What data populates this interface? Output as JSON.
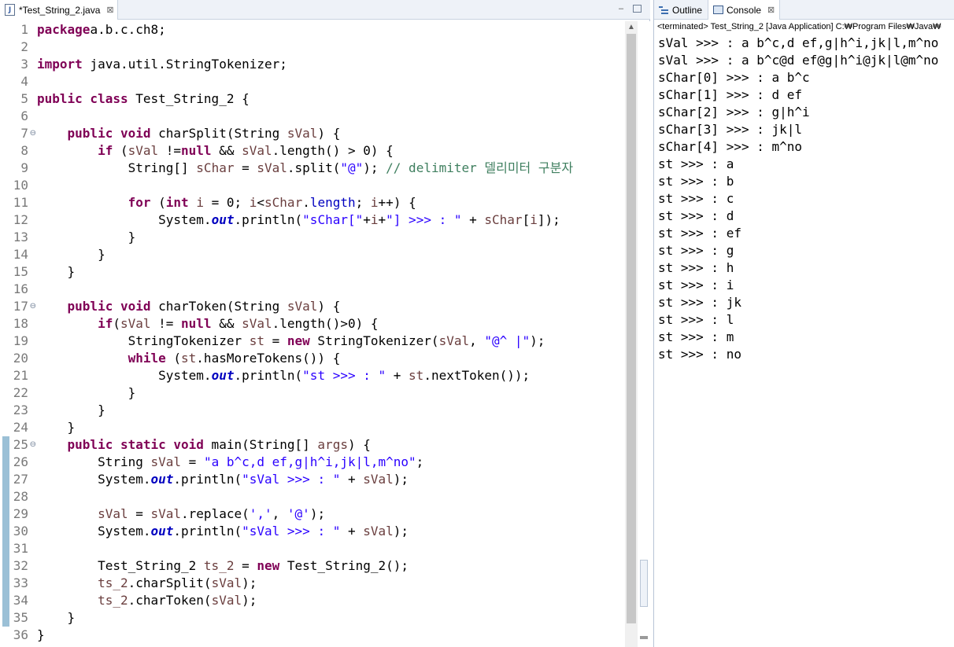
{
  "editor": {
    "tab_label": "*Test_String_2.java",
    "file_icon": "java-file-icon",
    "close_glyph": "⊠",
    "minimize_glyph": "▭"
  },
  "line_numbers": [
    "1",
    "2",
    "3",
    "4",
    "5",
    "6",
    "7",
    "8",
    "9",
    "10",
    "11",
    "12",
    "13",
    "14",
    "15",
    "16",
    "17",
    "18",
    "19",
    "20",
    "21",
    "22",
    "23",
    "24",
    "25",
    "26",
    "27",
    "28",
    "29",
    "30",
    "31",
    "32",
    "33",
    "34",
    "35",
    "36"
  ],
  "fold_markers": {
    "7": "⊖",
    "17": "⊖",
    "25": "⊖"
  },
  "code_lines": [
    [
      [
        "kw",
        "package"
      ],
      [
        "",
        "a.b.c.ch8;"
      ]
    ],
    [],
    [
      [
        "kw",
        "import"
      ],
      [
        "",
        " java.util.StringTokenizer;"
      ]
    ],
    [],
    [
      [
        "kw",
        "public class"
      ],
      [
        "",
        " Test_String_2 {"
      ]
    ],
    [],
    [
      [
        "",
        "    "
      ],
      [
        "kw",
        "public void"
      ],
      [
        "",
        " charSplit(String "
      ],
      [
        "lv",
        "sVal"
      ],
      [
        "",
        ") {"
      ]
    ],
    [
      [
        "",
        "        "
      ],
      [
        "kw",
        "if"
      ],
      [
        "",
        " ("
      ],
      [
        "lv",
        "sVal"
      ],
      [
        "",
        " !="
      ],
      [
        "kw",
        "null"
      ],
      [
        "",
        " && "
      ],
      [
        "lv",
        "sVal"
      ],
      [
        "",
        ".length() > 0) {"
      ]
    ],
    [
      [
        "",
        "            String[] "
      ],
      [
        "lv",
        "sChar"
      ],
      [
        "",
        " = "
      ],
      [
        "lv",
        "sVal"
      ],
      [
        "",
        ".split("
      ],
      [
        "str",
        "\"@\""
      ],
      [
        "",
        "); "
      ],
      [
        "cm",
        "// delimiter 델리미터 구분자"
      ]
    ],
    [],
    [
      [
        "",
        "            "
      ],
      [
        "kw",
        "for"
      ],
      [
        "",
        " ("
      ],
      [
        "kw",
        "int"
      ],
      [
        "",
        " "
      ],
      [
        "lv",
        "i"
      ],
      [
        "",
        " = 0; "
      ],
      [
        "lv",
        "i"
      ],
      [
        "",
        "<"
      ],
      [
        "lv",
        "sChar"
      ],
      [
        "",
        "."
      ],
      [
        "fld",
        "length"
      ],
      [
        "",
        "; "
      ],
      [
        "lv",
        "i"
      ],
      [
        "",
        "++) {"
      ]
    ],
    [
      [
        "",
        "                System."
      ],
      [
        "sfld",
        "out"
      ],
      [
        "",
        ".println("
      ],
      [
        "str",
        "\"sChar[\""
      ],
      [
        "",
        "+"
      ],
      [
        "lv",
        "i"
      ],
      [
        "",
        "+"
      ],
      [
        "str",
        "\"] >>> : \""
      ],
      [
        "",
        " + "
      ],
      [
        "lv",
        "sChar"
      ],
      [
        "",
        "["
      ],
      [
        "lv",
        "i"
      ],
      [
        "",
        "]);"
      ]
    ],
    [
      [
        "",
        "            }"
      ]
    ],
    [
      [
        "",
        "        }"
      ]
    ],
    [
      [
        "",
        "    }"
      ]
    ],
    [],
    [
      [
        "",
        "    "
      ],
      [
        "kw",
        "public void"
      ],
      [
        "",
        " charToken(String "
      ],
      [
        "lv",
        "sVal"
      ],
      [
        "",
        ") {"
      ]
    ],
    [
      [
        "",
        "        "
      ],
      [
        "kw",
        "if"
      ],
      [
        "",
        "("
      ],
      [
        "lv",
        "sVal"
      ],
      [
        "",
        " != "
      ],
      [
        "kw",
        "null"
      ],
      [
        "",
        " && "
      ],
      [
        "lv",
        "sVal"
      ],
      [
        "",
        ".length()>0) {"
      ]
    ],
    [
      [
        "",
        "            StringTokenizer "
      ],
      [
        "lv",
        "st"
      ],
      [
        "",
        " = "
      ],
      [
        "kw",
        "new"
      ],
      [
        "",
        " StringTokenizer("
      ],
      [
        "lv",
        "sVal"
      ],
      [
        "",
        ", "
      ],
      [
        "str",
        "\"@^ |\""
      ],
      [
        "",
        ");"
      ]
    ],
    [
      [
        "",
        "            "
      ],
      [
        "kw",
        "while"
      ],
      [
        "",
        " ("
      ],
      [
        "lv",
        "st"
      ],
      [
        "",
        ".hasMoreTokens()) {"
      ]
    ],
    [
      [
        "",
        "                System."
      ],
      [
        "sfld",
        "out"
      ],
      [
        "",
        ".println("
      ],
      [
        "str",
        "\"st >>> : \""
      ],
      [
        "",
        " + "
      ],
      [
        "lv",
        "st"
      ],
      [
        "",
        ".nextToken());"
      ]
    ],
    [
      [
        "",
        "            }"
      ]
    ],
    [
      [
        "",
        "        }"
      ]
    ],
    [
      [
        "",
        "    }"
      ]
    ],
    [
      [
        "",
        "    "
      ],
      [
        "kw",
        "public static void"
      ],
      [
        "",
        " main(String[] "
      ],
      [
        "lv",
        "args"
      ],
      [
        "",
        ") {"
      ]
    ],
    [
      [
        "",
        "        String "
      ],
      [
        "lv",
        "sVal"
      ],
      [
        "",
        " = "
      ],
      [
        "str",
        "\"a b^c,d ef,g|h^i,jk|l,m^no\""
      ],
      [
        "",
        ";"
      ]
    ],
    [
      [
        "",
        "        System."
      ],
      [
        "sfld",
        "out"
      ],
      [
        "",
        ".println("
      ],
      [
        "str",
        "\"sVal >>> : \""
      ],
      [
        "",
        " + "
      ],
      [
        "lv",
        "sVal"
      ],
      [
        "",
        ");"
      ]
    ],
    [],
    [
      [
        "",
        "        "
      ],
      [
        "lv",
        "sVal"
      ],
      [
        "",
        " = "
      ],
      [
        "lv",
        "sVal"
      ],
      [
        "",
        ".replace("
      ],
      [
        "str",
        "','"
      ],
      [
        "",
        ", "
      ],
      [
        "str",
        "'@'"
      ],
      [
        "",
        ");"
      ]
    ],
    [
      [
        "",
        "        System."
      ],
      [
        "sfld",
        "out"
      ],
      [
        "",
        ".println("
      ],
      [
        "str",
        "\"sVal >>> : \""
      ],
      [
        "",
        " + "
      ],
      [
        "lv",
        "sVal"
      ],
      [
        "",
        ");"
      ]
    ],
    [],
    [
      [
        "",
        "        Test_String_2 "
      ],
      [
        "lv",
        "ts_2"
      ],
      [
        "",
        " = "
      ],
      [
        "kw",
        "new"
      ],
      [
        "",
        " Test_String_2();"
      ]
    ],
    [
      [
        "",
        "        "
      ],
      [
        "lv",
        "ts_2"
      ],
      [
        "",
        ".charSplit("
      ],
      [
        "lv",
        "sVal"
      ],
      [
        "",
        ");"
      ]
    ],
    [
      [
        "",
        "        "
      ],
      [
        "lv",
        "ts_2"
      ],
      [
        "",
        ".charToken("
      ],
      [
        "lv",
        "sVal"
      ],
      [
        "",
        ");"
      ]
    ],
    [
      [
        "",
        "    }"
      ]
    ],
    [
      [
        "",
        "}"
      ]
    ]
  ],
  "console": {
    "outline_tab": "Outline",
    "console_tab": "Console",
    "close_glyph": "⊠",
    "status": "<terminated> Test_String_2 [Java Application] C:₩Program Files₩Java₩",
    "output_lines": [
      "sVal >>> : a b^c,d ef,g|h^i,jk|l,m^no",
      "sVal >>> : a b^c@d ef@g|h^i@jk|l@m^no",
      "sChar[0] >>> : a b^c",
      "sChar[1] >>> : d ef",
      "sChar[2] >>> : g|h^i",
      "sChar[3] >>> : jk|l",
      "sChar[4] >>> : m^no",
      "st >>> : a",
      "st >>> : b",
      "st >>> : c",
      "st >>> : d",
      "st >>> : ef",
      "st >>> : g",
      "st >>> : h",
      "st >>> : i",
      "st >>> : jk",
      "st >>> : l",
      "st >>> : m",
      "st >>> : no"
    ]
  },
  "colors": {
    "keyword": "#7f0055",
    "string": "#2a00ff",
    "comment": "#3f7f5f",
    "field": "#0000c0",
    "local_var": "#6a3e3e"
  }
}
